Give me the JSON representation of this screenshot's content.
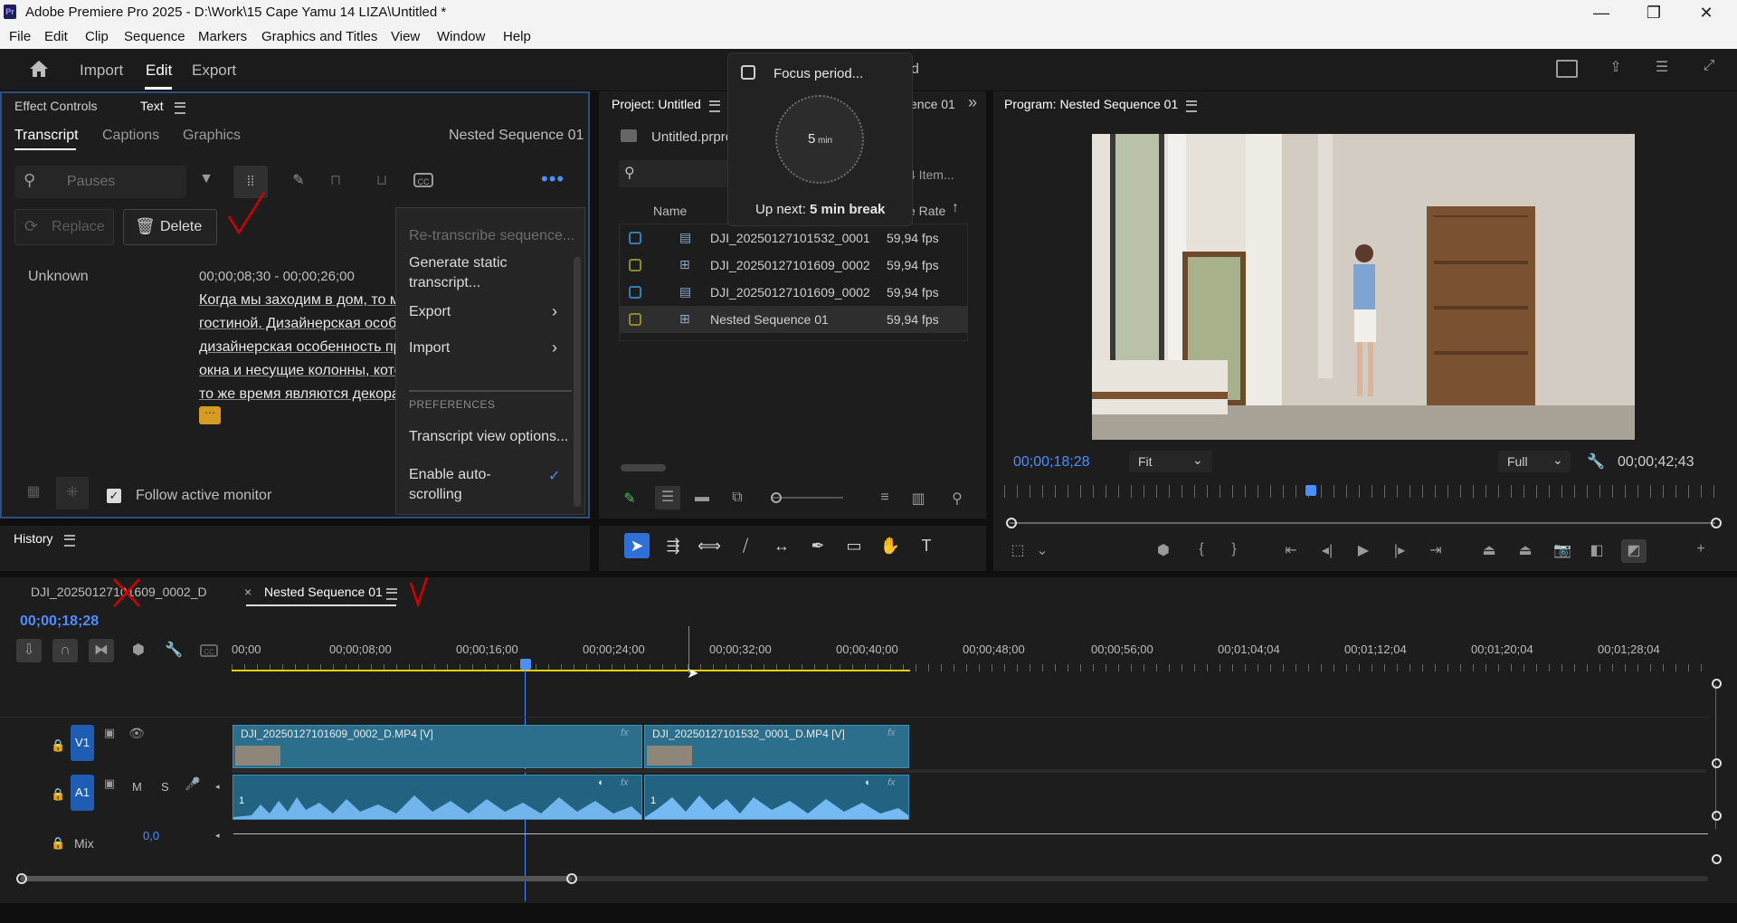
{
  "window": {
    "title": "Adobe Premiere Pro 2025 - D:\\Work\\15 Cape Yamu 14 LIZA\\Untitled *",
    "app_icon": "Pr",
    "controls": [
      "minimize-icon",
      "maximize-icon",
      "close-icon"
    ]
  },
  "menubar": [
    "File",
    "Edit",
    "Clip",
    "Sequence",
    "Markers",
    "Graphics and Titles",
    "View",
    "Window",
    "Help"
  ],
  "header": {
    "tabs": [
      "Import",
      "Edit",
      "Export"
    ],
    "active_tab": "Edit"
  },
  "text_panel": {
    "panel_tabs": [
      "Effect Controls",
      "Text"
    ],
    "sub_tabs": [
      "Transcript",
      "Captions",
      "Graphics"
    ],
    "sequence_name": "Nested Sequence 01",
    "search_placeholder": "Pauses",
    "replace_label": "Replace",
    "delete_label": "Delete",
    "speaker": "Unknown",
    "timecode_range": "00;00;08;30 - 00;00;26;00",
    "transcript_lines": [
      "Когда мы заходим в дом, то мы",
      "гостиной. Дизайнерская особе",
      "дизайнерская особенность пр",
      "окна и несущие колонны, кото",
      "то же время являются декорат"
    ],
    "follow_label": "Follow active monitor",
    "follow_checked": true
  },
  "context_menu": {
    "items": [
      {
        "label": "Re-transcribe sequence...",
        "disabled": true
      },
      {
        "label": "Generate static transcript...",
        "disabled": false
      },
      {
        "label": "Export",
        "submenu": true
      },
      {
        "label": "Import",
        "submenu": true
      }
    ],
    "section": "PREFERENCES",
    "pref_items": [
      {
        "label": "Transcript view options..."
      },
      {
        "label": "Enable auto-scrolling",
        "checked": true
      }
    ]
  },
  "focus_popup": {
    "title": "Focus period...",
    "minutes": "5",
    "unit": "min",
    "next_prefix": "Up next: ",
    "next_value": "5 min break"
  },
  "project_panel": {
    "title": "Project: Untitled",
    "second_tab_partial": "ence 01",
    "file_name": "Untitled.prpro",
    "item_count": "4 Item...",
    "columns": [
      "Name",
      "e Rate"
    ],
    "items": [
      {
        "name": "DJI_20250127101532_0001",
        "rate": "59,94 fps",
        "color": "#2f7fb5",
        "type": "clip"
      },
      {
        "name": "DJI_20250127101609_0002",
        "rate": "59,94 fps",
        "color": "#8b8b2a",
        "type": "sequence"
      },
      {
        "name": "DJI_20250127101609_0002",
        "rate": "59,94 fps",
        "color": "#2f7fb5",
        "type": "clip"
      },
      {
        "name": "Nested Sequence 01",
        "rate": "59,94 fps",
        "color": "#8b8b2a",
        "type": "sequence"
      }
    ],
    "selected_index": 3
  },
  "program_monitor": {
    "title": "Program: Nested Sequence 01",
    "current_time": "00;00;18;28",
    "fit": "Fit",
    "quality": "Full",
    "duration": "00;00;42;43"
  },
  "timeline": {
    "tabs": [
      {
        "label": "DJI_20250127101609_0002_D",
        "active": false
      },
      {
        "label": "Nested Sequence 01",
        "active": true
      }
    ],
    "current_time": "00;00;18;28",
    "ruler": [
      "00;00",
      "00;00;08;00",
      "00;00;16;00",
      "00;00;24;00",
      "00;00;32;00",
      "00;00;40;00",
      "00;00;48;00",
      "00;00;56;00",
      "00;01;04;04",
      "00;01;12;04",
      "00;01;20;04",
      "00;01;28;04"
    ],
    "tracks": {
      "video": {
        "label": "V1"
      },
      "audio": {
        "label": "A1",
        "m": "M",
        "s": "S"
      },
      "mix": {
        "label": "Mix",
        "value": "0,0"
      }
    },
    "clips": [
      {
        "name": "DJI_20250127101609_0002_D.MP4 [V]"
      },
      {
        "name": "DJI_20250127101532_0001_D.MP4 [V]"
      }
    ],
    "audio_clip_channel": "1"
  },
  "accent": "#4d8eff"
}
